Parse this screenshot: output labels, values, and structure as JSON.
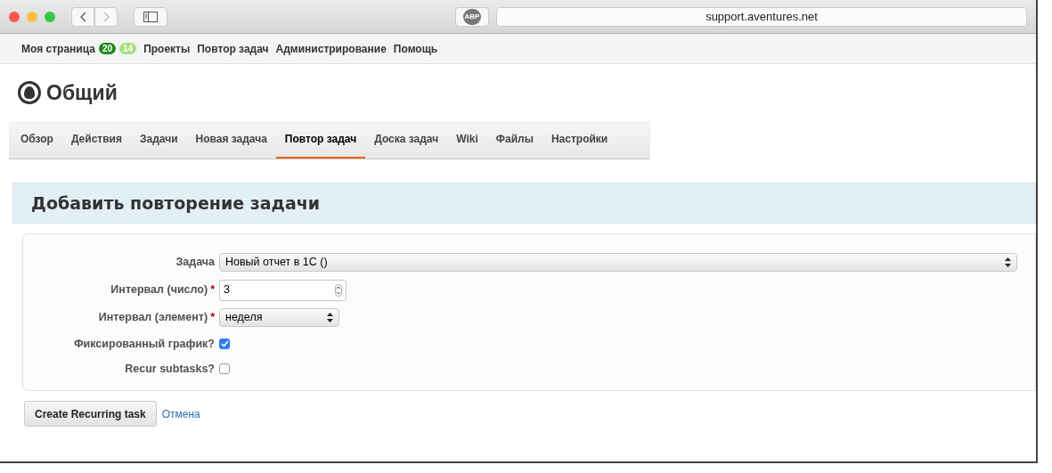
{
  "browser": {
    "url": "support.aventures.net",
    "adblock_label": "ABP"
  },
  "top_menu": [
    {
      "label": "Моя страница",
      "badges": [
        {
          "text": "20",
          "color": "#1f8a1f"
        },
        {
          "text": "14",
          "color": "#a6e07a"
        }
      ]
    },
    {
      "label": "Проекты"
    },
    {
      "label": "Повтор задач"
    },
    {
      "label": "Администрирование"
    },
    {
      "label": "Помощь"
    }
  ],
  "project": {
    "title": "Общий"
  },
  "tabs": [
    {
      "label": "Обзор",
      "selected": false
    },
    {
      "label": "Действия",
      "selected": false
    },
    {
      "label": "Задачи",
      "selected": false
    },
    {
      "label": "Новая задача",
      "selected": false
    },
    {
      "label": "Повтор задач",
      "selected": true
    },
    {
      "label": "Доска задач",
      "selected": false
    },
    {
      "label": "Wiki",
      "selected": false
    },
    {
      "label": "Файлы",
      "selected": false
    },
    {
      "label": "Настройки",
      "selected": false
    }
  ],
  "form": {
    "title": "Добавить повторение задачи",
    "fields": [
      {
        "kind": "wide_select",
        "label": "Задача",
        "value": "Новый отчет в 1С ()"
      },
      {
        "kind": "number",
        "label": "Интервал (число)",
        "required_mark": "*",
        "value": "3"
      },
      {
        "kind": "select",
        "label": "Интервал (элемент)",
        "required_mark": "*",
        "value": "неделя"
      },
      {
        "kind": "checkbox",
        "label": "Фиксированный график?",
        "checked": true
      },
      {
        "kind": "checkbox",
        "label": "Recur subtasks?",
        "checked": false
      }
    ],
    "submit": "Create Recurring task",
    "cancel": "Отмена"
  }
}
